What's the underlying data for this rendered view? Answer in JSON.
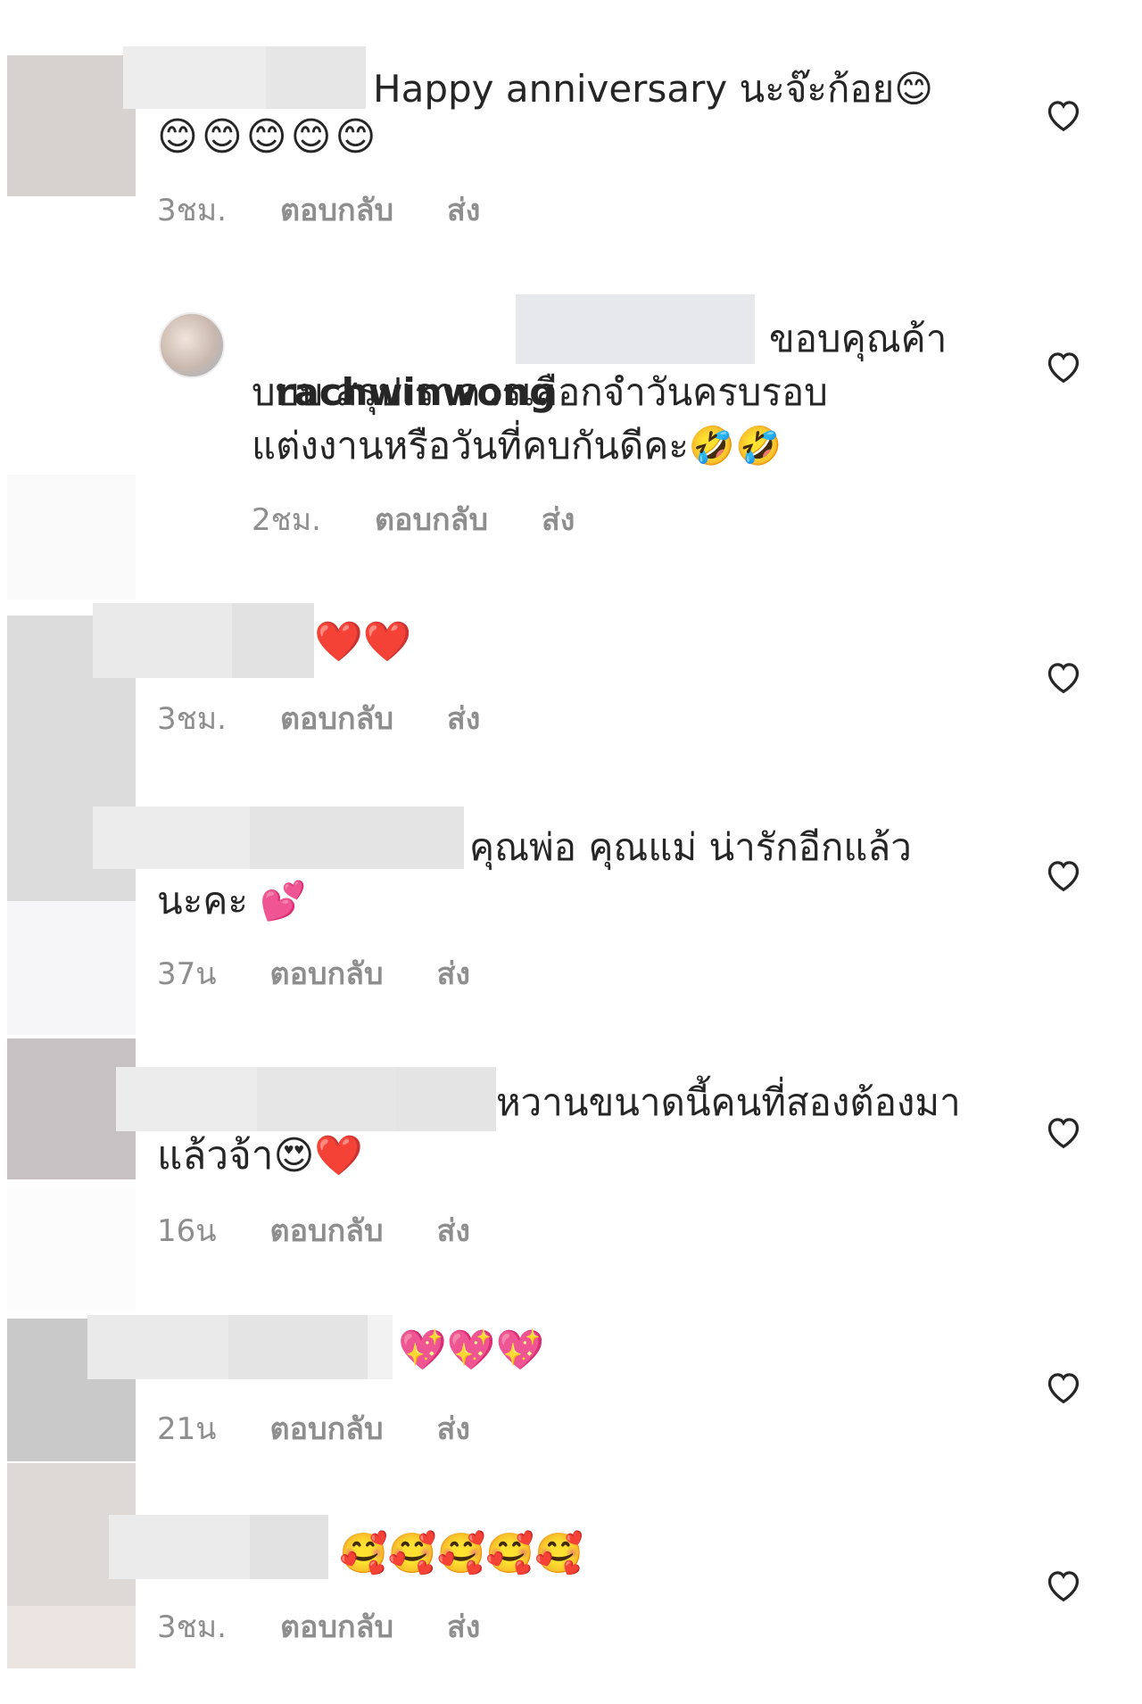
{
  "comments": [
    {
      "username": "",
      "text": "Happy anniversary นะจ๊ะก้อย😊",
      "text2": "😊😊😊😊😊",
      "time": "3ชม.",
      "reply_label": "ตอบกลับ",
      "send_label": "ส่ง"
    },
    {
      "username": "rachwinwong",
      "text": "ขอบคุณค้า",
      "text2": "บบบ สรุปเราควรเลือกจำวันครบรอบ",
      "text3": "แต่งงานหรือวันที่คบกันดีคะ🤣🤣",
      "time": "2ชม.",
      "reply_label": "ตอบกลับ",
      "send_label": "ส่ง"
    },
    {
      "username": "",
      "text": "❤️❤️",
      "time": "3ชม.",
      "reply_label": "ตอบกลับ",
      "send_label": "ส่ง"
    },
    {
      "username": "",
      "text": "คุณพ่อ คุณแม่ น่ารักอีกแล้ว",
      "text2": "นะคะ 💕",
      "time": "37น",
      "reply_label": "ตอบกลับ",
      "send_label": "ส่ง"
    },
    {
      "username": "",
      "text": "หวานขนาดนี้คนที่สองต้องมา",
      "text2": "แล้วจ้า😍❤️",
      "time": "16น",
      "reply_label": "ตอบกลับ",
      "send_label": "ส่ง"
    },
    {
      "username": "",
      "text": "💖💖💖",
      "time": "21น",
      "reply_label": "ตอบกลับ",
      "send_label": "ส่ง"
    },
    {
      "username": "",
      "text": "🥰🥰🥰🥰🥰",
      "time": "3ชม.",
      "reply_label": "ตอบกลับ",
      "send_label": "ส่ง"
    }
  ],
  "colors": {
    "text": "#262626",
    "meta": "#8e8e8e",
    "blur": "#e6e6e6"
  },
  "icons": {
    "like": "heart-outline-icon"
  }
}
